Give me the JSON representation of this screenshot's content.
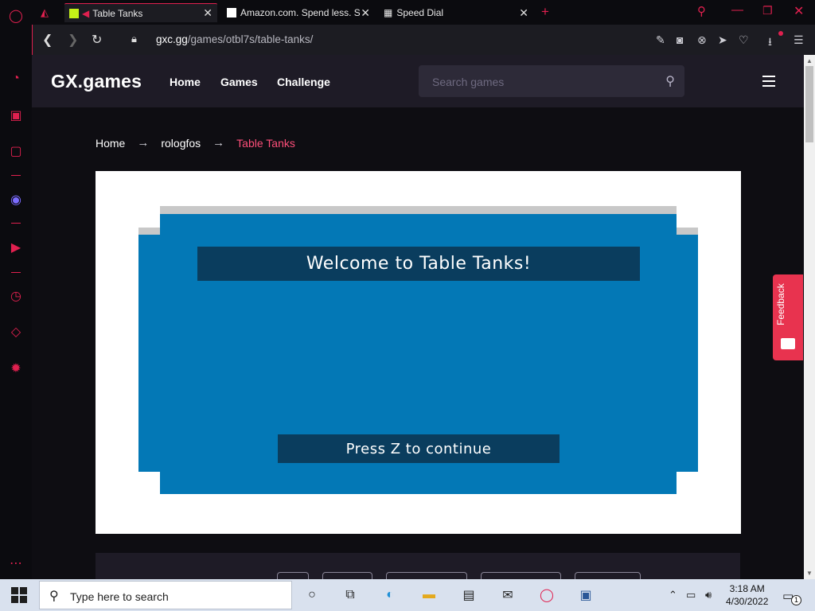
{
  "browser": {
    "tabs": [
      {
        "title": "Table Tanks",
        "active": true
      },
      {
        "title": "Amazon.com. Spend less. S",
        "active": false
      },
      {
        "title": "Speed Dial",
        "active": false
      }
    ],
    "new_tab": "+",
    "url": {
      "host": "gxc.gg",
      "path": "/games/otbl7s/table-tanks/"
    }
  },
  "site": {
    "logo": "GX.games",
    "nav": [
      "Home",
      "Games",
      "Challenge"
    ],
    "search_placeholder": "Search games"
  },
  "breadcrumb": {
    "items": [
      "Home",
      "rologfos",
      "Table Tanks"
    ],
    "separator": "→"
  },
  "game": {
    "title": "Welcome to Table Tanks!",
    "prompt": "Press Z to continue",
    "colors": {
      "background": "#0378b6",
      "panel": "#0a3d5e",
      "frame_top": "#c8c8c8"
    }
  },
  "feedback_label": "Feedback",
  "taskbar": {
    "search_placeholder": "Type here to search",
    "time": "3:18 AM",
    "date": "4/30/2022",
    "notification_count": "1"
  },
  "colors": {
    "accent": "#e0204f",
    "breadcrumb_current": "#ff4f7a",
    "header_bg": "#1e1b26"
  }
}
